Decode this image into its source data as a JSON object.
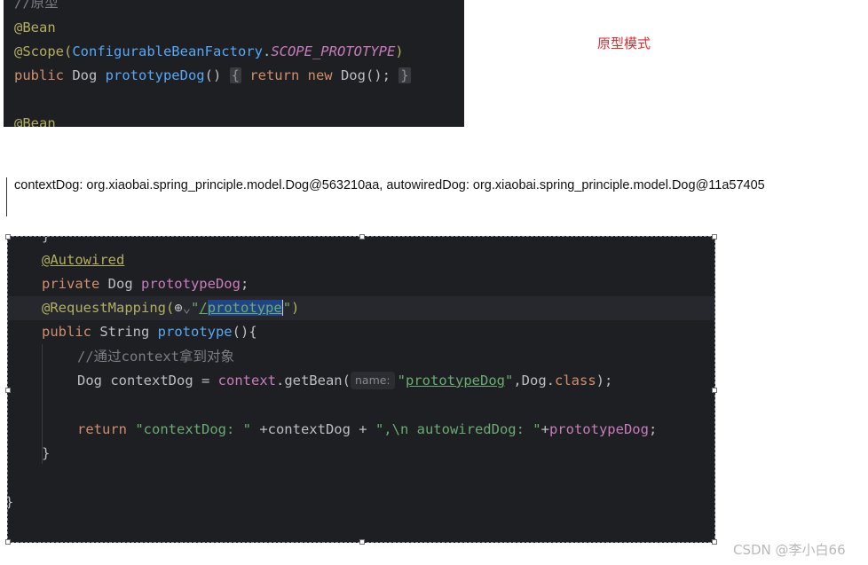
{
  "top_snippet": {
    "comment": "//原型",
    "bean1": "@Bean",
    "scope_prefix": "@Scope(",
    "scope_class": "ConfigurableBeanFactory",
    "scope_dot": ".",
    "scope_const": "SCOPE_PROTOTYPE",
    "scope_close": ")",
    "decl_public": "public ",
    "decl_type": "Dog ",
    "decl_method": "prototypeDog",
    "decl_parens": "() ",
    "fold_open": "{",
    "return_kw": " return ",
    "new_kw": "new ",
    "new_expr": "Dog(); ",
    "fold_close": "}",
    "bean2": "@Bean"
  },
  "label_prototype": "原型模式",
  "output_line": "contextDog: org.xiaobai.spring_principle.model.Dog@563210aa, autowiredDog: org.xiaobai.spring_principle.model.Dog@11a57405",
  "bottom_editor": {
    "brace_top": "}",
    "autowired": "@Autowired",
    "private_kw": "private ",
    "field_type": "Dog ",
    "field_name": "prototypeDog",
    "semicolon": ";",
    "mapping_prefix": "@RequestMapping(",
    "globe_icon": "⊕",
    "chevron": "⌄",
    "quote_open": "\"",
    "path_slash": "/",
    "path_name": "prototype",
    "quote_close": "\"",
    "mapping_close": ")",
    "method_public": "public ",
    "method_type": "String ",
    "method_name": "prototype",
    "method_tail": "(){",
    "comment": "//通过context拿到对象",
    "local_type": "Dog ",
    "local_name": "contextDog = ",
    "context_var": "context",
    "getbean": ".getBean(",
    "hint_name": "name:",
    "arg_str_q1": "\"",
    "arg_str": "prototypeDog",
    "arg_str_q2": "\"",
    "arg_class_prefix": ",Dog.",
    "class_kw": "class",
    "arg_close": ");",
    "return_kw": "return ",
    "str1": "\"contextDog: \"",
    "concat1": " +contextDog + ",
    "str2": "\",\\n autowiredDog: \"",
    "concat2": "+",
    "field_ref": "prototypeDog",
    "semicolon2": ";",
    "close_method": "}",
    "close_class": "}"
  },
  "watermark": "CSDN @李小白66"
}
